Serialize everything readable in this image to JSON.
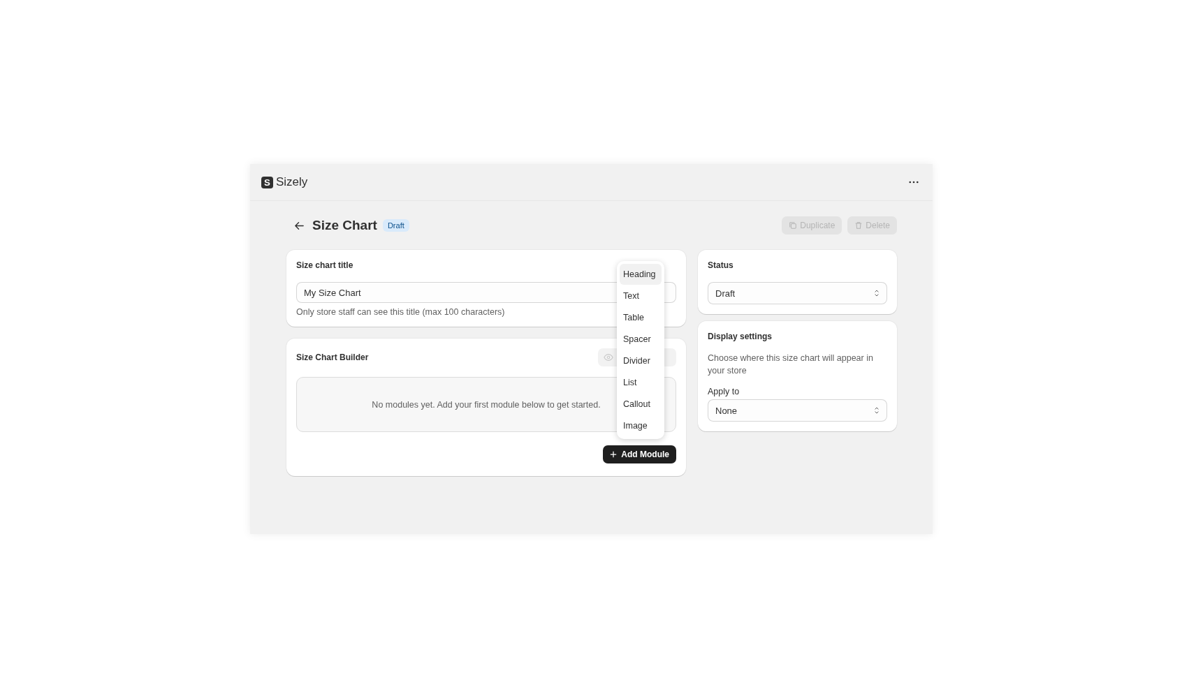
{
  "app": {
    "name": "Sizely",
    "logo_letter": "S"
  },
  "page": {
    "title": "Size Chart",
    "badge": "Draft"
  },
  "actions": [
    {
      "label": "Duplicate",
      "kind": "duplicate",
      "disabled": true
    },
    {
      "label": "Delete",
      "kind": "delete",
      "disabled": true
    }
  ],
  "title_card": {
    "heading": "Size chart title",
    "value": "My Size Chart",
    "help": "Only store staff can see this title (max 100 characters)"
  },
  "builder_card": {
    "heading": "Size Chart Builder",
    "empty": "No modules yet. Add your first module below to get started.",
    "add_button": "Add Module"
  },
  "module_menu": [
    {
      "label": "Heading",
      "selected": true
    },
    {
      "label": "Text",
      "selected": false
    },
    {
      "label": "Table",
      "selected": false
    },
    {
      "label": "Spacer",
      "selected": false
    },
    {
      "label": "Divider",
      "selected": false
    },
    {
      "label": "List",
      "selected": false
    },
    {
      "label": "Callout",
      "selected": false
    },
    {
      "label": "Image",
      "selected": false
    }
  ],
  "status_card": {
    "heading": "Status",
    "value": "Draft"
  },
  "display_card": {
    "heading": "Display settings",
    "description": "Choose where this size chart will appear in your store",
    "field_label": "Apply to",
    "value": "None"
  }
}
